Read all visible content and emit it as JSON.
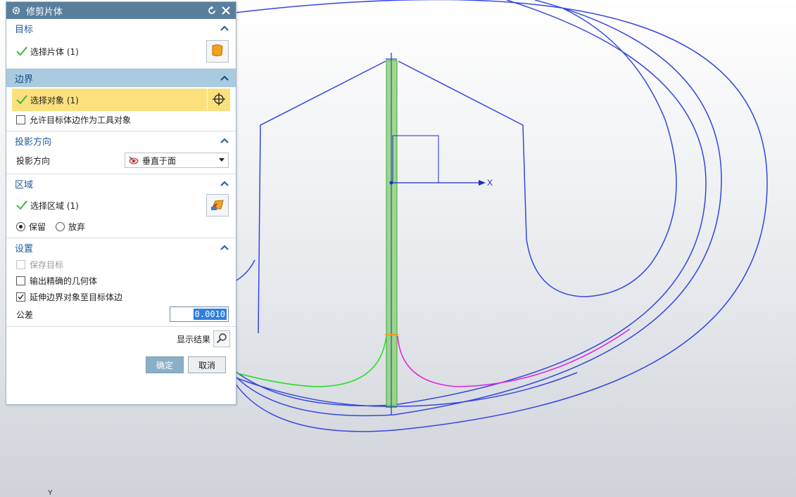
{
  "dialog": {
    "title": "修剪片体",
    "target": {
      "title": "目标",
      "select_label": "选择片体 (1)"
    },
    "boundary": {
      "title": "边界",
      "select_label": "选择对象 (1)",
      "allow_option": "允许目标体边作为工具对象",
      "allow_checked": false
    },
    "projection": {
      "title": "投影方向",
      "label": "投影方向",
      "value": "垂直于面"
    },
    "region": {
      "title": "区域",
      "select_label": "选择区域 (1)",
      "keep": "保留",
      "discard": "放弃",
      "selected": "keep"
    },
    "settings": {
      "title": "设置",
      "save_target": "保存目标",
      "exact_geometry": "输出精确的几何体",
      "extend_boundary": "延伸边界对象至目标体边",
      "tolerance_label": "公差",
      "tolerance_value": "0.0010"
    },
    "show_result": "显示结果",
    "ok": "确定",
    "cancel": "取消"
  },
  "viewport": {
    "x_axis": "X",
    "y_axis": "Y"
  },
  "colors": {
    "titlebar": "#5a7f9d",
    "section_title": "#1f5b9b",
    "active_section": "#a9cbe0",
    "highlight": "#fbe07d",
    "curve_blue": "#3446e0",
    "curve_green": "#22dd22",
    "curve_magenta": "#e020e0",
    "sheet_green": "#8fd17a"
  },
  "icons": [
    "gear-icon",
    "reset-icon",
    "close-icon",
    "checkmark-icon",
    "sheet-body-icon",
    "crosshair-icon",
    "normal-to-face-icon",
    "region-icon",
    "magnifier-icon",
    "chevron-up-icon"
  ]
}
